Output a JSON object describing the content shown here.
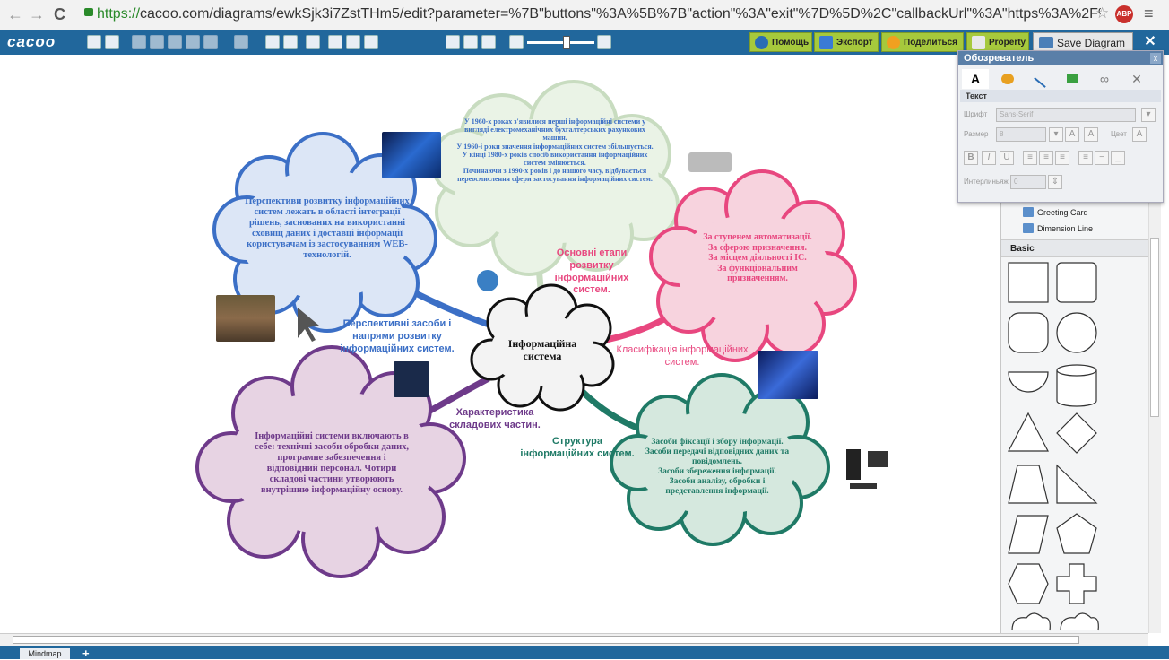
{
  "browser": {
    "url_scheme": "https://",
    "url_rest": "cacoo.com/diagrams/ewkSjk3i7ZstTHm5/edit?parameter=%7B\"buttons\"%3A%5B%7B\"action\"%3A\"exit\"%7D%5D%2C\"callbackUrl\"%3A\"https%3A%2F%2Fcacoo.cor",
    "back": "←",
    "forward": "→",
    "reload": "C",
    "star": "☆",
    "abp": "ABP",
    "menu": "≡"
  },
  "toolbar": {
    "logo": "cacoo",
    "help_label": "Помощь",
    "export_label": "Экспорт",
    "share_label": "Поделиться",
    "property_label": "Property",
    "save_label": "Save Diagram",
    "close_label": "✕"
  },
  "diagram": {
    "center": "Інформаційна система",
    "top_cloud": "У 1960-х роках з'явилися перші інформаційні системи у вигляді електромеханічних бухгалтерських рахункових машин.\nУ 1960-і роки значення інформаційних систем збільшується.\nУ кінці 1980-х років спосіб використання інформаційних систем змінюється.\nПочинаючи з 1990-х років і до нашого часу, відбувається переосмислення сфери застосування інформаційних систем.",
    "top_branch": "Основні етапи розвитку інформаційних систем.",
    "left_cloud": "Перспективи розвитку інформаційних систем лежать в області інтеграції рішень, заснованих на використанні сховищ даних і доставці інформації користувачам із застосуванням WEB-технологій.",
    "left_branch": "Перспективні засоби і напрями розвитку інформаційних систем.",
    "right_cloud": "За ступенем автоматизації.\nЗа сферою призначення.\nЗа місцем діяльності ІС.\nЗа функціональним призначенням.",
    "right_branch": "Класифікація інформаційних систем.",
    "bottom_left_cloud": "Інформаційні системи включають в себе: технічні засоби обробки даних, програмне забезпечення і відповідний персонал. Чотири складові частини утворюють внутрішню інформаційну основу.",
    "bottom_left_branch": "Характеристика складових частин.",
    "bottom_right_cloud": "Засоби фіксації і збору інформації.\nЗасоби передачі відповідних даних та повідомлень.\nЗасоби збереження інформації.\nЗасоби аналізу, обробки і представлення інформації.",
    "bottom_right_branch": "Структура інформаційних систем."
  },
  "colors": {
    "blue": "#3b6fc6",
    "green_light": "#c8dcc0",
    "pink": "#e8477f",
    "purple": "#6e3a8a",
    "teal": "#1f7a66",
    "toolbar": "#21679c"
  },
  "panel": {
    "title": "Обозреватель",
    "close": "x",
    "tab_text": "A",
    "section": "Текст",
    "font_label": "Шрифт",
    "font_value": "Sans-Serif",
    "size_label": "Размер",
    "size_value": "8",
    "color_label": "Цвет",
    "spacing_label": "Интерлиньяж",
    "spacing_value": "0"
  },
  "library": {
    "items": [
      "Greeting Card",
      "Dimension Line"
    ],
    "basic_label": "Basic"
  },
  "bottom": {
    "sheet_tab": "Mindmap",
    "add_tab": "+"
  }
}
